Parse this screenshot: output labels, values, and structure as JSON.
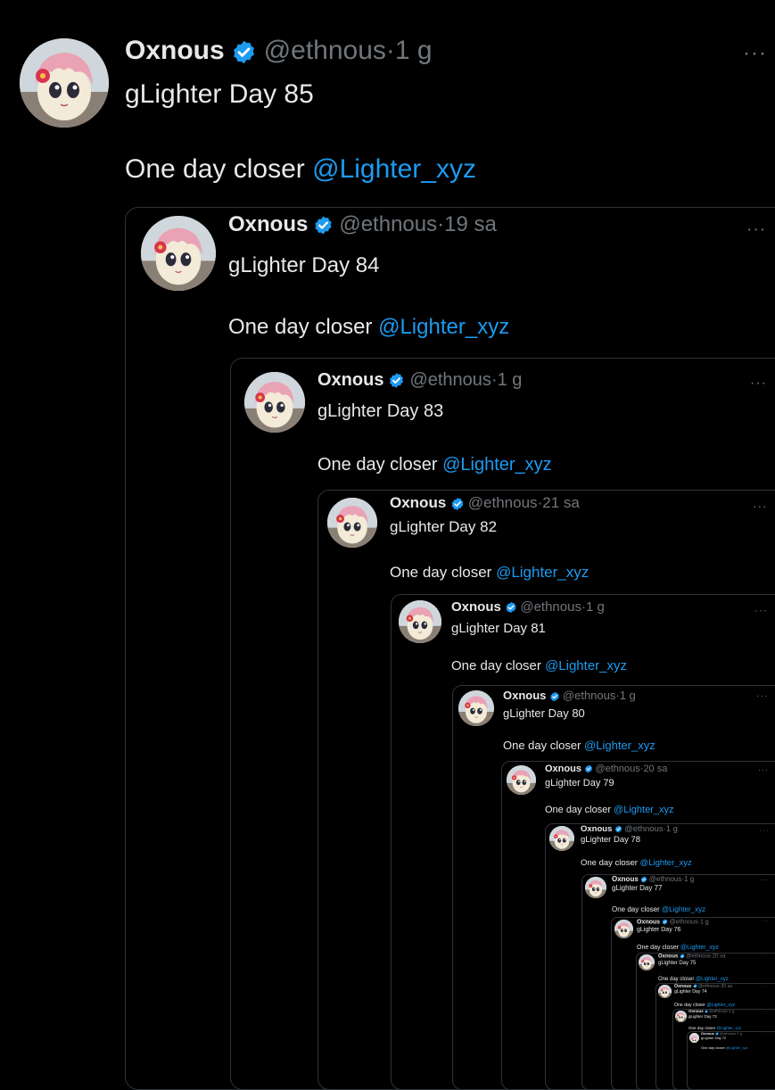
{
  "colors": {
    "background": "#000000",
    "text": "#e7e9ea",
    "muted": "#71767b",
    "link": "#1d9bf0",
    "verified": "#1d9bf0",
    "border": "#2f3336"
  },
  "icons": {
    "verified": "verified-badge-icon",
    "more": "more-options-icon"
  },
  "tweets": [
    {
      "name": "Oxnous",
      "handle": "@ethnous",
      "sep": "·",
      "time": "1 g",
      "line1": "gLighter Day 85",
      "line2": "One day closer",
      "mention": "@Lighter_xyz",
      "more": "···"
    },
    {
      "name": "Oxnous",
      "handle": "@ethnous",
      "sep": "·",
      "time": "19 sa",
      "line1": "gLighter Day 84",
      "line2": "One day closer",
      "mention": "@Lighter_xyz",
      "more": "···"
    },
    {
      "name": "Oxnous",
      "handle": "@ethnous",
      "sep": "·",
      "time": "1 g",
      "line1": "gLighter Day 83",
      "line2": "One day closer",
      "mention": "@Lighter_xyz",
      "more": "···"
    },
    {
      "name": "Oxnous",
      "handle": "@ethnous",
      "sep": "·",
      "time": "21 sa",
      "line1": "gLighter Day 82",
      "line2": "One day closer",
      "mention": "@Lighter_xyz",
      "more": "···"
    },
    {
      "name": "Oxnous",
      "handle": "@ethnous",
      "sep": "·",
      "time": "1 g",
      "line1": "gLighter Day 81",
      "line2": "One day closer",
      "mention": "@Lighter_xyz",
      "more": "···"
    },
    {
      "name": "Oxnous",
      "handle": "@ethnous",
      "sep": "·",
      "time": "1 g",
      "line1": "gLighter Day 80",
      "line2": "One day closer",
      "mention": "@Lighter_xyz",
      "more": "···"
    },
    {
      "name": "Oxnous",
      "handle": "@ethnous",
      "sep": "·",
      "time": "20 sa",
      "line1": "gLighter Day 79",
      "line2": "One day closer",
      "mention": "@Lighter_xyz",
      "more": "···"
    },
    {
      "name": "Oxnous",
      "handle": "@ethnous",
      "sep": "·",
      "time": "1 g",
      "line1": "gLighter Day 78",
      "line2": "One day closer",
      "mention": "@Lighter_xyz",
      "more": "···"
    },
    {
      "name": "Oxnous",
      "handle": "@ethnous",
      "sep": "·",
      "time": "1 g",
      "line1": "gLighter Day 77",
      "line2": "One day closer",
      "mention": "@Lighter_xyz",
      "more": "···"
    },
    {
      "name": "Oxnous",
      "handle": "@ethnous",
      "sep": "·",
      "time": "1 g",
      "line1": "gLighter Day 76",
      "line2": "One day closer",
      "mention": "@Lighter_xyz",
      "more": "···"
    },
    {
      "name": "Oxnous",
      "handle": "@ethnous",
      "sep": "·",
      "time": "20 sa",
      "line1": "gLighter Day 75",
      "line2": "One day closer",
      "mention": "@Lighter_xyz",
      "more": "···"
    },
    {
      "name": "Oxnous",
      "handle": "@ethnous",
      "sep": "·",
      "time": "20 sa",
      "line1": "gLighter Day 74",
      "line2": "One day closer",
      "mention": "@Lighter_xyz",
      "more": "···"
    },
    {
      "name": "Oxnous",
      "handle": "@ethnous",
      "sep": "·",
      "time": "1 g",
      "line1": "gLighter Day 73",
      "line2": "One day closer",
      "mention": "@Lighter_xyz",
      "more": "···"
    },
    {
      "name": "Oxnous",
      "handle": "@ethnous",
      "sep": "·",
      "time": "1 g",
      "line1": "gLighter Day 72",
      "line2": "One day closer",
      "mention": "@Lighter_xyz",
      "more": "···"
    }
  ]
}
